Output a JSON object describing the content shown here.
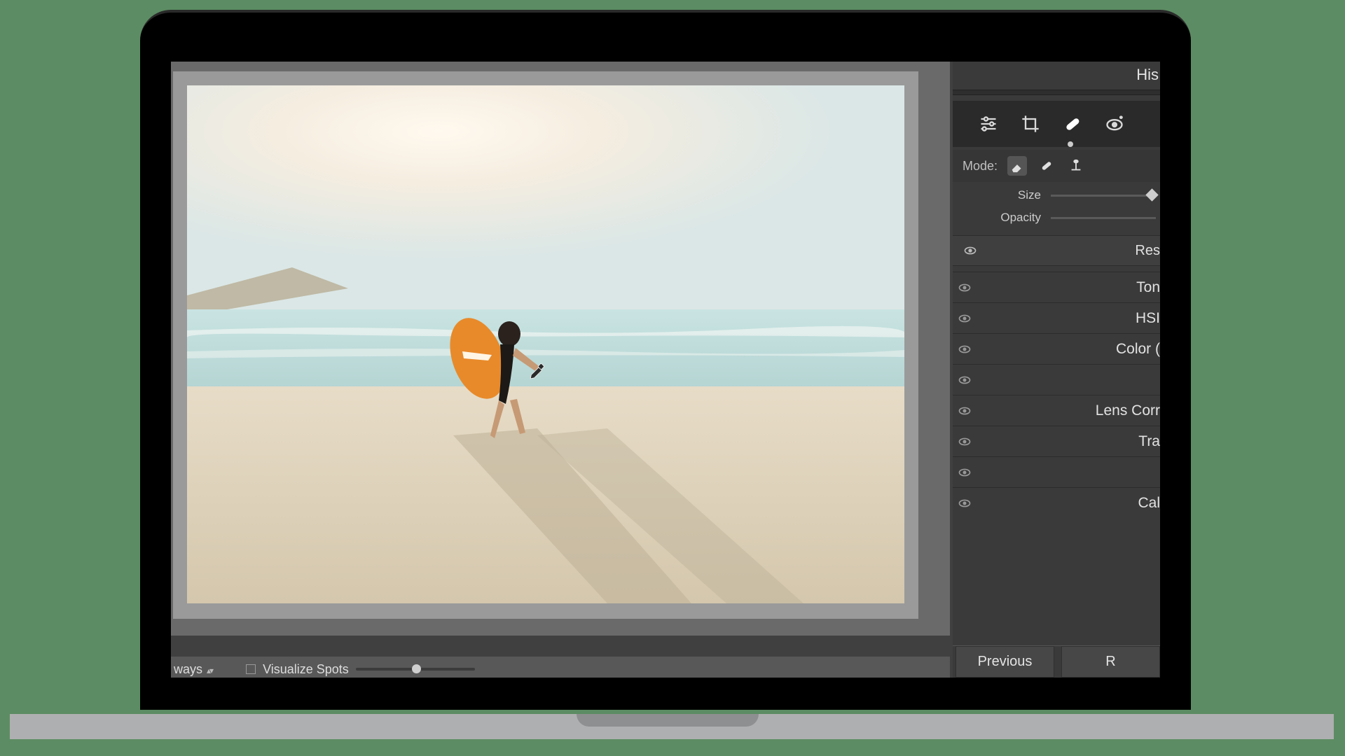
{
  "header": {
    "histogram_label_partial": "His"
  },
  "tools": {
    "mode_label": "Mode:",
    "size_label": "Size",
    "opacity_label": "Opacity",
    "reset_partial": "Res"
  },
  "panels": [
    {
      "label": "Ton"
    },
    {
      "label": "HSI"
    },
    {
      "label": "Color ("
    },
    {
      "label": ""
    },
    {
      "label": "Lens Corr"
    },
    {
      "label": "Tra"
    },
    {
      "label": ""
    },
    {
      "label": "Cal"
    }
  ],
  "bottom": {
    "always_partial": "ways",
    "visualize_label": "Visualize Spots"
  },
  "buttons": {
    "previous": "Previous",
    "reset_partial": "R"
  }
}
